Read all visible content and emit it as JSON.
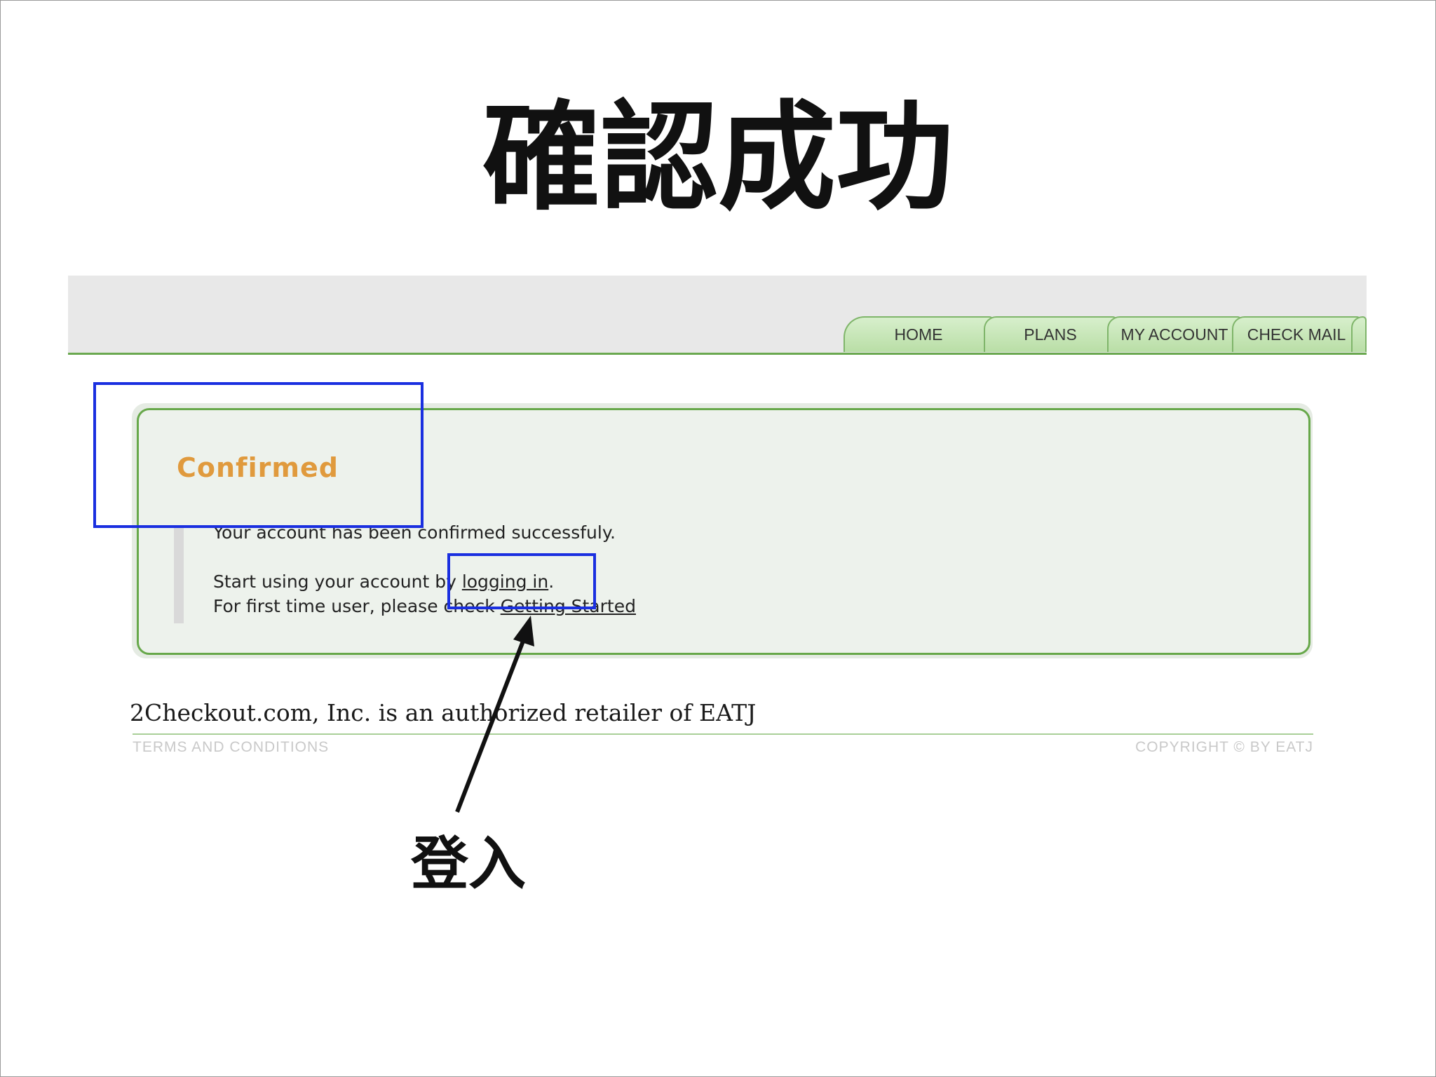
{
  "slide": {
    "title": "確認成功",
    "callout_label": "登入",
    "annotation_color": "#1a2fe0"
  },
  "nav": {
    "tabs": [
      "HOME",
      "PLANS",
      "MY ACCOUNT",
      "CHECK MAIL"
    ]
  },
  "panel": {
    "heading": "Confirmed",
    "line1": "Your account has been confirmed successfuly.",
    "line2_prefix": "Start using your account by ",
    "login_link": "logging in",
    "line2_suffix": ".",
    "line3_prefix": "For first time user, please check ",
    "getting_started_link": "Getting Started"
  },
  "footer": {
    "retailer_notice": "2Checkout.com, Inc. is an authorized retailer of EATJ",
    "terms_link": "TERMS AND CONDITIONS",
    "copyright": "COPYRIGHT © BY EATJ"
  },
  "colors": {
    "accent_green": "#67a84a",
    "heading_orange": "#e09a3d"
  }
}
